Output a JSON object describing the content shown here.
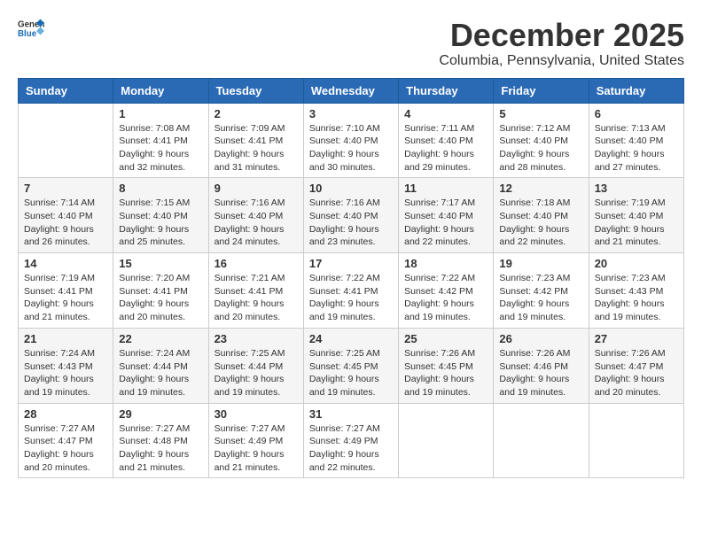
{
  "logo": {
    "general": "General",
    "blue": "Blue"
  },
  "title": "December 2025",
  "location": "Columbia, Pennsylvania, United States",
  "days_header": [
    "Sunday",
    "Monday",
    "Tuesday",
    "Wednesday",
    "Thursday",
    "Friday",
    "Saturday"
  ],
  "weeks": [
    [
      {
        "day": "",
        "info": ""
      },
      {
        "day": "1",
        "info": "Sunrise: 7:08 AM\nSunset: 4:41 PM\nDaylight: 9 hours\nand 32 minutes."
      },
      {
        "day": "2",
        "info": "Sunrise: 7:09 AM\nSunset: 4:41 PM\nDaylight: 9 hours\nand 31 minutes."
      },
      {
        "day": "3",
        "info": "Sunrise: 7:10 AM\nSunset: 4:40 PM\nDaylight: 9 hours\nand 30 minutes."
      },
      {
        "day": "4",
        "info": "Sunrise: 7:11 AM\nSunset: 4:40 PM\nDaylight: 9 hours\nand 29 minutes."
      },
      {
        "day": "5",
        "info": "Sunrise: 7:12 AM\nSunset: 4:40 PM\nDaylight: 9 hours\nand 28 minutes."
      },
      {
        "day": "6",
        "info": "Sunrise: 7:13 AM\nSunset: 4:40 PM\nDaylight: 9 hours\nand 27 minutes."
      }
    ],
    [
      {
        "day": "7",
        "info": "Sunrise: 7:14 AM\nSunset: 4:40 PM\nDaylight: 9 hours\nand 26 minutes."
      },
      {
        "day": "8",
        "info": "Sunrise: 7:15 AM\nSunset: 4:40 PM\nDaylight: 9 hours\nand 25 minutes."
      },
      {
        "day": "9",
        "info": "Sunrise: 7:16 AM\nSunset: 4:40 PM\nDaylight: 9 hours\nand 24 minutes."
      },
      {
        "day": "10",
        "info": "Sunrise: 7:16 AM\nSunset: 4:40 PM\nDaylight: 9 hours\nand 23 minutes."
      },
      {
        "day": "11",
        "info": "Sunrise: 7:17 AM\nSunset: 4:40 PM\nDaylight: 9 hours\nand 22 minutes."
      },
      {
        "day": "12",
        "info": "Sunrise: 7:18 AM\nSunset: 4:40 PM\nDaylight: 9 hours\nand 22 minutes."
      },
      {
        "day": "13",
        "info": "Sunrise: 7:19 AM\nSunset: 4:40 PM\nDaylight: 9 hours\nand 21 minutes."
      }
    ],
    [
      {
        "day": "14",
        "info": "Sunrise: 7:19 AM\nSunset: 4:41 PM\nDaylight: 9 hours\nand 21 minutes."
      },
      {
        "day": "15",
        "info": "Sunrise: 7:20 AM\nSunset: 4:41 PM\nDaylight: 9 hours\nand 20 minutes."
      },
      {
        "day": "16",
        "info": "Sunrise: 7:21 AM\nSunset: 4:41 PM\nDaylight: 9 hours\nand 20 minutes."
      },
      {
        "day": "17",
        "info": "Sunrise: 7:22 AM\nSunset: 4:41 PM\nDaylight: 9 hours\nand 19 minutes."
      },
      {
        "day": "18",
        "info": "Sunrise: 7:22 AM\nSunset: 4:42 PM\nDaylight: 9 hours\nand 19 minutes."
      },
      {
        "day": "19",
        "info": "Sunrise: 7:23 AM\nSunset: 4:42 PM\nDaylight: 9 hours\nand 19 minutes."
      },
      {
        "day": "20",
        "info": "Sunrise: 7:23 AM\nSunset: 4:43 PM\nDaylight: 9 hours\nand 19 minutes."
      }
    ],
    [
      {
        "day": "21",
        "info": "Sunrise: 7:24 AM\nSunset: 4:43 PM\nDaylight: 9 hours\nand 19 minutes."
      },
      {
        "day": "22",
        "info": "Sunrise: 7:24 AM\nSunset: 4:44 PM\nDaylight: 9 hours\nand 19 minutes."
      },
      {
        "day": "23",
        "info": "Sunrise: 7:25 AM\nSunset: 4:44 PM\nDaylight: 9 hours\nand 19 minutes."
      },
      {
        "day": "24",
        "info": "Sunrise: 7:25 AM\nSunset: 4:45 PM\nDaylight: 9 hours\nand 19 minutes."
      },
      {
        "day": "25",
        "info": "Sunrise: 7:26 AM\nSunset: 4:45 PM\nDaylight: 9 hours\nand 19 minutes."
      },
      {
        "day": "26",
        "info": "Sunrise: 7:26 AM\nSunset: 4:46 PM\nDaylight: 9 hours\nand 19 minutes."
      },
      {
        "day": "27",
        "info": "Sunrise: 7:26 AM\nSunset: 4:47 PM\nDaylight: 9 hours\nand 20 minutes."
      }
    ],
    [
      {
        "day": "28",
        "info": "Sunrise: 7:27 AM\nSunset: 4:47 PM\nDaylight: 9 hours\nand 20 minutes."
      },
      {
        "day": "29",
        "info": "Sunrise: 7:27 AM\nSunset: 4:48 PM\nDaylight: 9 hours\nand 21 minutes."
      },
      {
        "day": "30",
        "info": "Sunrise: 7:27 AM\nSunset: 4:49 PM\nDaylight: 9 hours\nand 21 minutes."
      },
      {
        "day": "31",
        "info": "Sunrise: 7:27 AM\nSunset: 4:49 PM\nDaylight: 9 hours\nand 22 minutes."
      },
      {
        "day": "",
        "info": ""
      },
      {
        "day": "",
        "info": ""
      },
      {
        "day": "",
        "info": ""
      }
    ]
  ]
}
